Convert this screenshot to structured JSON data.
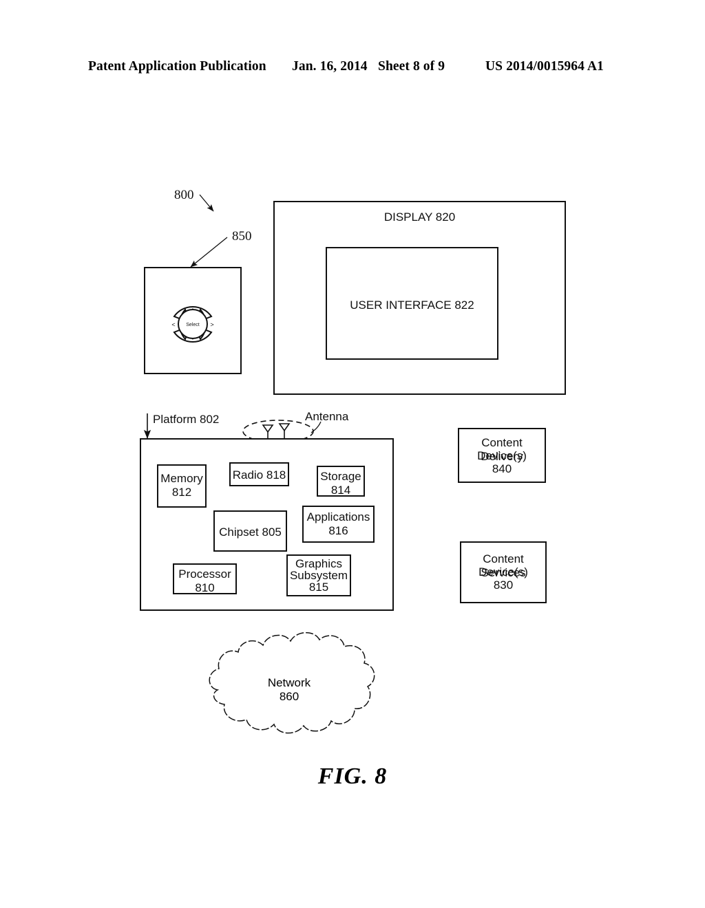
{
  "page_header": {
    "publication": "Patent Application Publication",
    "date": "Jan. 16, 2014",
    "sheet": "Sheet 8 of 9",
    "publication_number": "US 2014/0015964 A1"
  },
  "figure": {
    "caption": "FIG. 8",
    "system_ref": "800"
  },
  "navigation_controller": {
    "ref": "850",
    "select_label": "Select",
    "up_label": "▲",
    "down_label": "▼",
    "left_label": "<",
    "right_label": ">"
  },
  "display": {
    "label": "DISPLAY 820",
    "user_interface_label": "USER INTERFACE 822"
  },
  "platform": {
    "label": "Platform 802",
    "antenna_label": "Antenna",
    "components": [
      {
        "id": "memory",
        "line1": "Memory",
        "line2": "812"
      },
      {
        "id": "radio",
        "line1": "Radio 818",
        "line2": ""
      },
      {
        "id": "storage",
        "line1": "Storage",
        "line2": "814"
      },
      {
        "id": "chipset",
        "line1": "Chipset 805",
        "line2": ""
      },
      {
        "id": "applications",
        "line1": "Applications",
        "line2": "816"
      },
      {
        "id": "processor",
        "line1": "Processor",
        "line2": "810"
      },
      {
        "id": "graphics",
        "line1": "Graphics",
        "line2": "Subsystem",
        "line3": "815"
      }
    ]
  },
  "content_delivery": {
    "line1": "Content Delivery",
    "line2": "Device(s)",
    "line3": "840"
  },
  "content_services": {
    "line1": "Content Services",
    "line2": "Device(s)",
    "line3": "830"
  },
  "network": {
    "line1": "Network",
    "line2": "860"
  },
  "colors": {
    "ink": "#111111",
    "paper": "#ffffff"
  }
}
